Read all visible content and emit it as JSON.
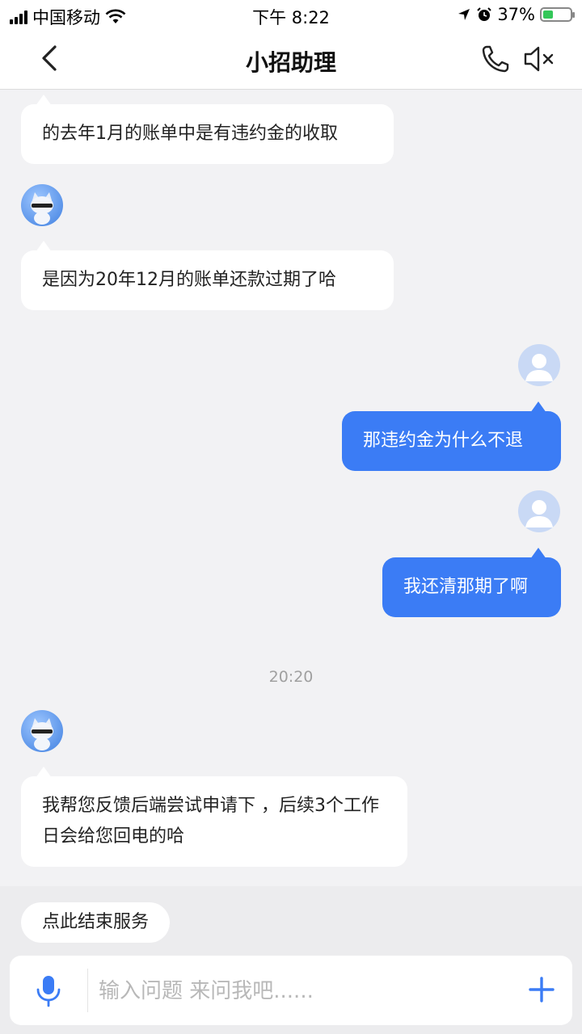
{
  "status_bar": {
    "carrier": "中国移动",
    "time": "下午 8:22",
    "battery_percent": "37%",
    "battery_level": 0.37,
    "icons": [
      "signal-icon",
      "wifi-icon",
      "location-icon",
      "alarm-icon",
      "battery-icon"
    ]
  },
  "navbar": {
    "title": "小招助理",
    "icons": [
      "back-icon",
      "phone-icon",
      "speaker-mute-icon"
    ]
  },
  "messages": [
    {
      "from": "bot",
      "text": "的去年1月的账单中是有违约金的收取"
    },
    {
      "from": "bot",
      "text": "是因为20年12月的账单还款过期了哈"
    },
    {
      "from": "user",
      "text": "那违约金为什么不退"
    },
    {
      "from": "user",
      "text": "我还清那期了啊"
    },
    {
      "from": "bot",
      "text": "我帮您反馈后端尝试申请下 ，后续3个工作日会给您回电的哈"
    }
  ],
  "timestamp": "20:20",
  "end_service_label": "点此结束服务",
  "input": {
    "placeholder": "输入问题 来问我吧......",
    "value": ""
  },
  "colors": {
    "accent": "#3b7cf5",
    "background": "#f2f2f4"
  }
}
